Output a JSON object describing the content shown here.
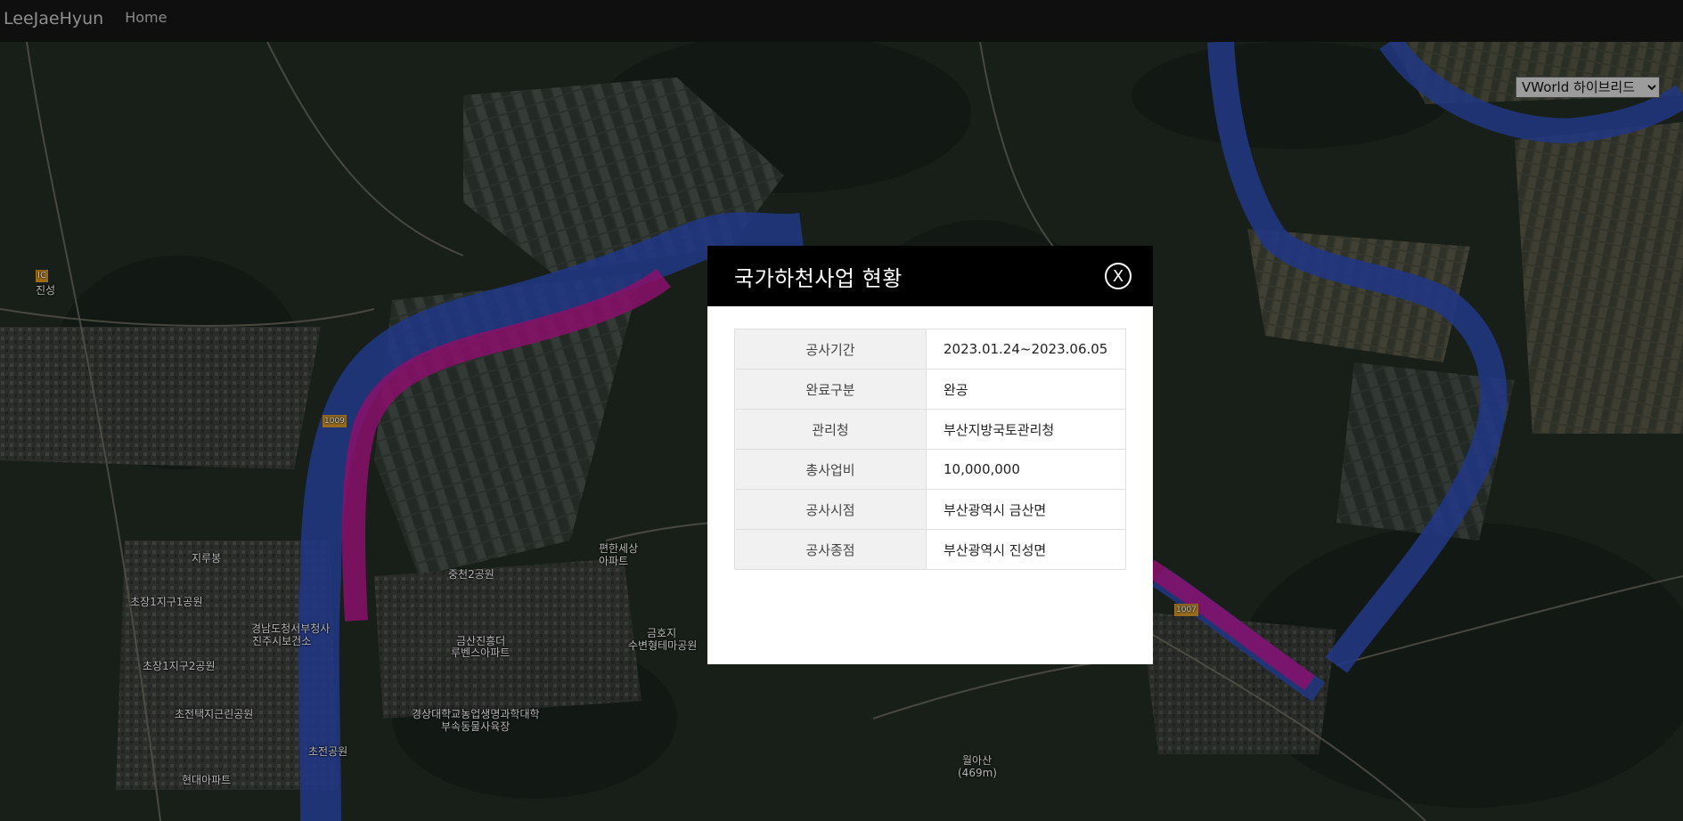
{
  "navbar": {
    "brand": "LeeJaeHyun",
    "home": "Home"
  },
  "map": {
    "layer_select": {
      "selected": "VWorld 하이브리드"
    },
    "labels": {
      "jinseong": "진성",
      "jirubong": "지루봉",
      "chojang1_park": "초장1지구1공원",
      "gyeongnam_office_1": "경남도청서부청사",
      "gyeongnam_office_2": "진주시보건소",
      "chojang1_park2": "초장1지구2공원",
      "chojeon_park": "초전택지근린공원",
      "hyundai_apt": "현대아파트",
      "chojeon_park_short": "초전공원",
      "jungcheon_park": "중천2공원",
      "geumsan_1": "금산진흥더",
      "geumsan_2": "루벤스아파트",
      "gnu_1": "경상대학교농업생명과학대학",
      "gnu_2": "부속동물사육장",
      "pyeonhan_1": "편한세상",
      "pyeonhan_2": "아파트",
      "geumho_1": "금호지",
      "geumho_2": "수변형테마공원",
      "wolasan_1": "월아산",
      "wolasan_2": "(469m)",
      "road_100": "1009",
      "road_1007": "1007",
      "ic": "IC"
    },
    "colors": {
      "river": "#2a47a8",
      "project": "#b0148a",
      "terrain": "#222a22"
    }
  },
  "modal": {
    "title": "국가하천사업 현황",
    "close_label": "X",
    "rows": [
      {
        "label": "공사기간",
        "value": "2023.01.24~2023.06.05"
      },
      {
        "label": "완료구분",
        "value": "완공"
      },
      {
        "label": "관리청",
        "value": "부산지방국토관리청"
      },
      {
        "label": "총사업비",
        "value": "10,000,000"
      },
      {
        "label": "공사시점",
        "value": "부산광역시 금산면"
      },
      {
        "label": "공사종점",
        "value": "부산광역시 진성면"
      }
    ]
  }
}
